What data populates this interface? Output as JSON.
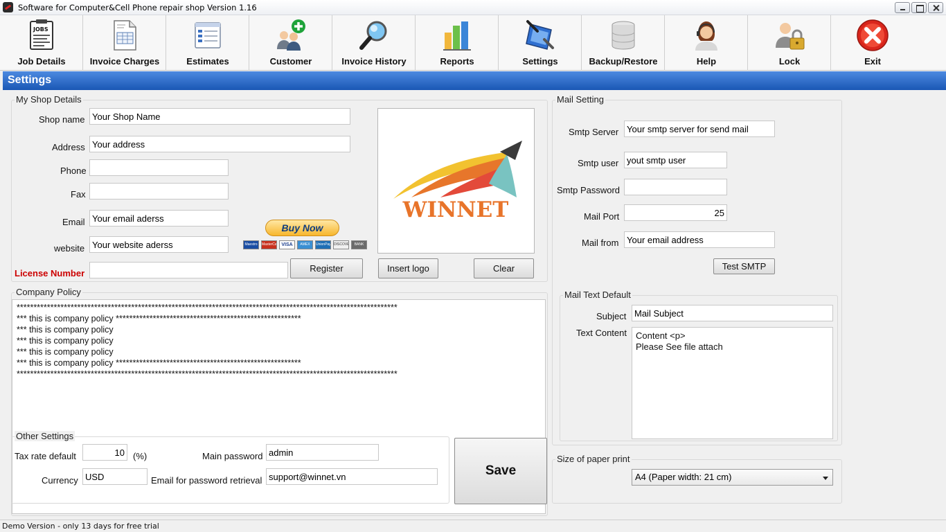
{
  "window": {
    "title": "Software for Computer&Cell Phone repair shop Version 1.16"
  },
  "toolbar": {
    "items": [
      {
        "label": "Job Details",
        "icon": "jobs-clipboard-icon"
      },
      {
        "label": "Invoice Charges",
        "icon": "invoice-document-icon"
      },
      {
        "label": "Estimates",
        "icon": "estimate-sheet-icon"
      },
      {
        "label": "Customer",
        "icon": "add-customer-icon"
      },
      {
        "label": "Invoice History",
        "icon": "magnifier-icon"
      },
      {
        "label": "Reports",
        "icon": "bar-chart-icon"
      },
      {
        "label": "Settings",
        "icon": "settings-tools-icon"
      },
      {
        "label": "Backup/Restore",
        "icon": "database-icon"
      },
      {
        "label": "Help",
        "icon": "support-agent-icon"
      },
      {
        "label": "Lock",
        "icon": "user-lock-icon"
      },
      {
        "label": "Exit",
        "icon": "exit-red-x-icon"
      }
    ]
  },
  "section_title": "Settings",
  "shop": {
    "legend": "My Shop Details",
    "shop_name_label": "Shop name",
    "shop_name": "Your Shop Name",
    "address_label": "Address",
    "address": "Your address",
    "phone_label": "Phone",
    "phone": "",
    "fax_label": "Fax",
    "fax": "",
    "email_label": "Email",
    "email": "Your email aderss",
    "website_label": "website",
    "website": "Your website aderss",
    "license_label": "License Number",
    "license": "",
    "register_label": "Register",
    "insert_logo_label": "Insert logo",
    "clear_label": "Clear",
    "logo_text": "WINNET",
    "buy_now_label": "Buy Now",
    "card_labels": [
      "Maestro",
      "MasterCard",
      "VISA",
      "AMEX",
      "UnionPay",
      "DISCOVER",
      "BANK"
    ]
  },
  "policy": {
    "legend": "Company Policy",
    "text": "*****************************************************************************************************************\n*** this is company policy *******************************************************\n*** this is company policy\n*** this is company policy\n*** this is company policy\n*** this is company policy *******************************************************\n*****************************************************************************************************************"
  },
  "other": {
    "legend": "Other Settings",
    "tax_label": "Tax rate default",
    "tax": "10",
    "percent": "(%)",
    "currency_label": "Currency",
    "currency": "USD",
    "main_password_label": "Main password",
    "main_password": "admin",
    "retrieval_email_label": "Email for password retrieval",
    "retrieval_email": "support@winnet.vn",
    "save_label": "Save"
  },
  "mail": {
    "legend": "Mail Setting",
    "server_label": "Smtp Server",
    "server": "Your smtp server for send mail",
    "user_label": "Smtp user",
    "user": "yout smtp user",
    "password_label": "Smtp Password",
    "password": "",
    "port_label": "Mail Port",
    "port": "25",
    "from_label": "Mail from",
    "from": "Your email address",
    "test_label": "Test SMTP"
  },
  "mail_text": {
    "legend": "Mail Text Default",
    "subject_label": "Subject",
    "subject": "Mail Subject",
    "content_label": "Text Content",
    "content": "Content <p>\nPlease See file attach"
  },
  "paper": {
    "legend": "Size of paper print",
    "selected": "A4 (Paper width: 21 cm)"
  },
  "status": {
    "text": "Demo Version - only 13 days for free trial"
  },
  "colors": {
    "header_blue": "#1f5fbf",
    "license_red": "#cc0000",
    "logo_orange": "#e8742a"
  }
}
